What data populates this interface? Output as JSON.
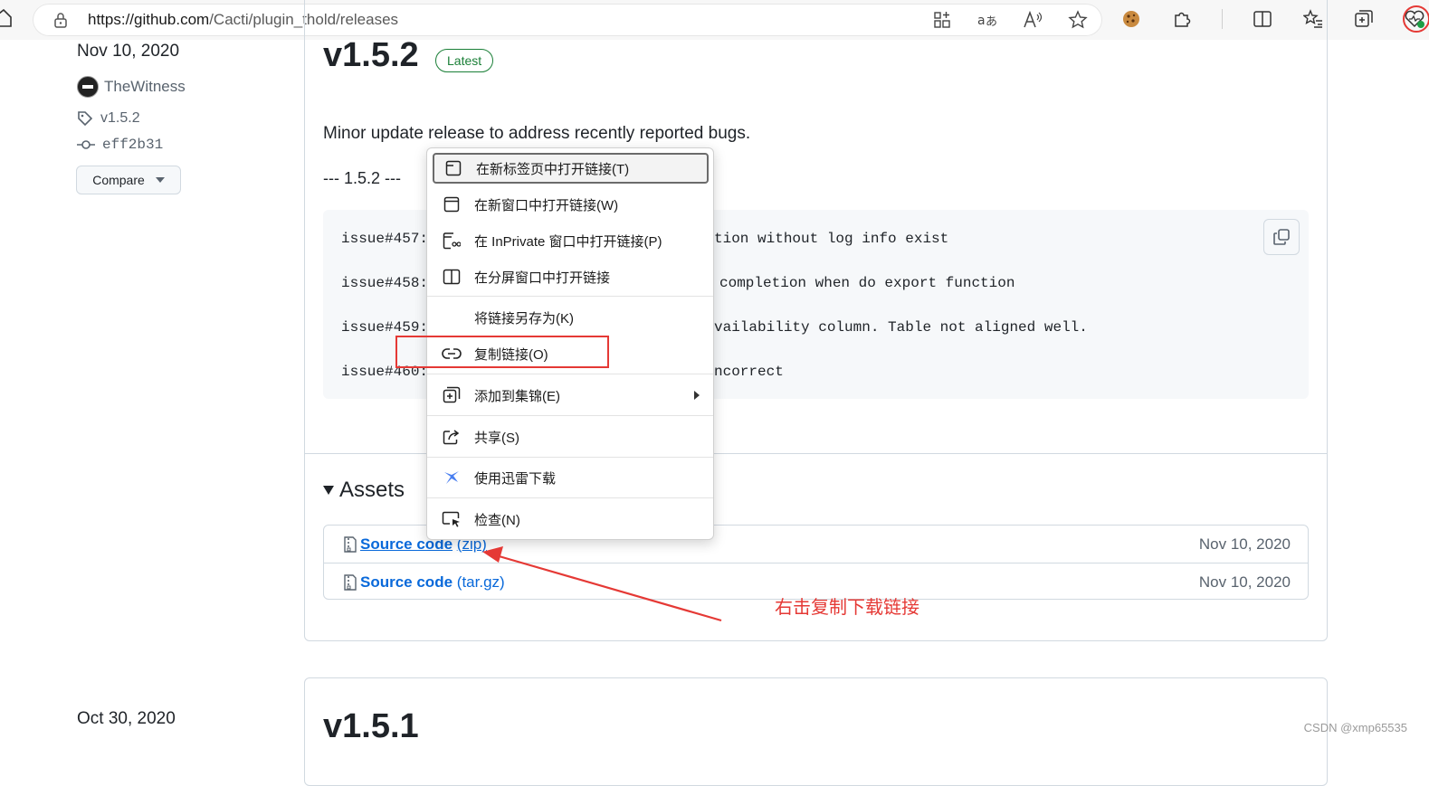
{
  "browser": {
    "url_prefix": "https://github.com",
    "url_path": "/Cacti/plugin_thold/releases"
  },
  "release": {
    "date": "Nov 10, 2020",
    "author": "TheWitness",
    "tag": "v1.5.2",
    "commit": "eff2b31",
    "compare_label": "Compare",
    "title": "v1.5.2",
    "badge": "Latest",
    "description": "Minor update release to address recently reported bugs.",
    "version_line": "--- 1.5.2 ---",
    "code_lines": [
      {
        "issue": "issue#457:",
        "tail": "tion without log info exist"
      },
      {
        "issue": "issue#458:",
        "tail": "completion when do export function"
      },
      {
        "issue": "issue#459:",
        "tail": "vailability column. Table not aligned well."
      },
      {
        "issue": "issue#460:",
        "tail": "ncorrect"
      }
    ],
    "assets_heading": "Assets",
    "assets": [
      {
        "name": "Source code",
        "ext": "(zip)",
        "date": "Nov 10, 2020"
      },
      {
        "name": "Source code",
        "ext": "(tar.gz)",
        "date": "Nov 10, 2020"
      }
    ]
  },
  "next_release": {
    "date": "Oct 30, 2020",
    "title": "v1.5.1"
  },
  "context_menu": {
    "items": [
      {
        "label": "在新标签页中打开链接(T)",
        "icon": "new-tab-icon"
      },
      {
        "label": "在新窗口中打开链接(W)",
        "icon": "new-window-icon"
      },
      {
        "label": "在 InPrivate 窗口中打开链接(P)",
        "icon": "inprivate-icon"
      },
      {
        "label": "在分屏窗口中打开链接",
        "icon": "split-screen-icon"
      },
      {
        "label": "将链接另存为(K)",
        "icon": ""
      },
      {
        "label": "复制链接(O)",
        "icon": "link-icon"
      },
      {
        "label": "添加到集锦(E)",
        "icon": "collections-icon"
      },
      {
        "label": "共享(S)",
        "icon": "share-icon"
      },
      {
        "label": "使用迅雷下载",
        "icon": "thunder-icon"
      },
      {
        "label": "检查(N)",
        "icon": "inspect-icon"
      }
    ]
  },
  "annotation": "右击复制下载链接",
  "watermark": "CSDN @xmp65535",
  "colors": {
    "link": "#0969da",
    "latest_green": "#1a7f37",
    "annotation_red": "#e53935"
  }
}
